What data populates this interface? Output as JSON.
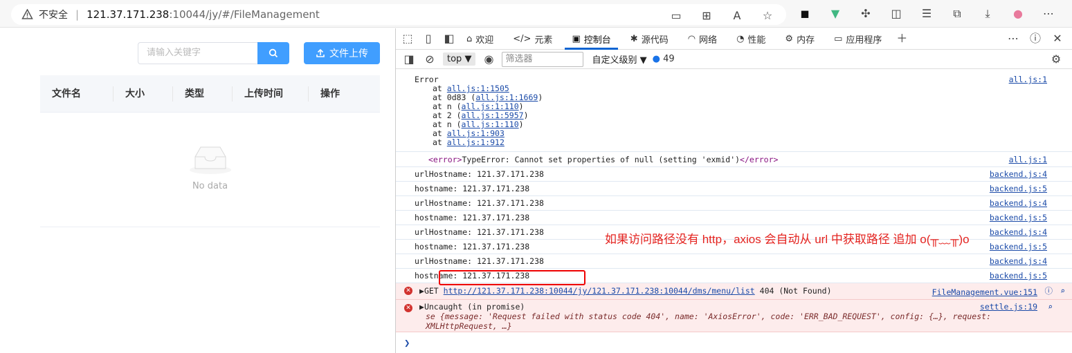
{
  "browser": {
    "security_label": "不安全",
    "url_host": "121.37.171.238",
    "url_path": ":10044/jy/#/FileManagement"
  },
  "app": {
    "search_placeholder": "请输入关键字",
    "upload_label": "文件上传",
    "columns": [
      "文件名",
      "大小",
      "类型",
      "上传时间",
      "操作"
    ],
    "empty_text": "No data"
  },
  "devtools": {
    "tabs": [
      "欢迎",
      "元素",
      "控制台",
      "源代码",
      "网络",
      "性能",
      "内存",
      "应用程序"
    ],
    "active_tab": "控制台",
    "context": "top",
    "filter_placeholder": "筛选器",
    "level": "自定义级别",
    "message_count": "49"
  },
  "console": {
    "error_block": {
      "header": "Error",
      "source": "all.js:1",
      "stack": [
        {
          "prefix": "at ",
          "link": "all.js:1:1505",
          "suffix": ""
        },
        {
          "prefix": "at 0d83 (",
          "link": "all.js:1:1669",
          "suffix": ")"
        },
        {
          "prefix": "at n (",
          "link": "all.js:1:110",
          "suffix": ")"
        },
        {
          "prefix": "at 2 (",
          "link": "all.js:1:5957",
          "suffix": ")"
        },
        {
          "prefix": "at n (",
          "link": "all.js:1:110",
          "suffix": ")"
        },
        {
          "prefix": "at ",
          "link": "all.js:1:903",
          "suffix": ""
        },
        {
          "prefix": "at ",
          "link": "all.js:1:912",
          "suffix": ""
        }
      ]
    },
    "error_tag_line": {
      "open": "<error>",
      "text": "TypeError: Cannot set properties of null (setting 'exmid')",
      "close": "</error>",
      "source": "all.js:1"
    },
    "logs": [
      {
        "text": "urlHostname:  121.37.171.238",
        "source": "backend.js:4"
      },
      {
        "text": "hostname:  121.37.171.238",
        "source": "backend.js:5"
      },
      {
        "text": "urlHostname:  121.37.171.238",
        "source": "backend.js:4"
      },
      {
        "text": "hostname:  121.37.171.238",
        "source": "backend.js:5"
      },
      {
        "text": "urlHostname:  121.37.171.238",
        "source": "backend.js:4"
      },
      {
        "text": "hostname:  121.37.171.238",
        "source": "backend.js:5"
      },
      {
        "text": "urlHostname:  121.37.171.238",
        "source": "backend.js:4"
      },
      {
        "text": "hostname:  121.37.171.238",
        "source": "backend.js:5"
      }
    ],
    "get_error": {
      "method": "GET",
      "url": "http://121.37.171.238:10044/jy/121.37.171.238:10044/dms/menu/list",
      "status": "404 (Not Found)",
      "source": "FileManagement.vue:151"
    },
    "promise_error": {
      "title": "Uncaught (in promise)",
      "detail": "se {message: 'Request failed with status code 404', name: 'AxiosError', code: 'ERR_BAD_REQUEST', config: {…}, request: XMLHttpRequest, …}",
      "source": "settle.js:19"
    },
    "annotation": "如果访问路径没有 http，axios 会自动从 url 中获取路径 追加 o(╥﹏╥)o"
  }
}
